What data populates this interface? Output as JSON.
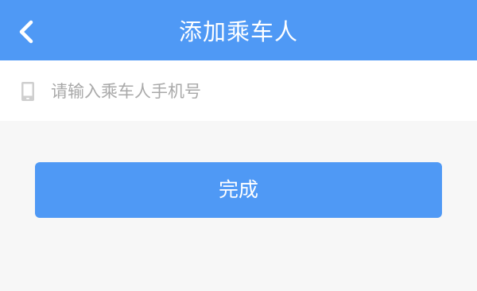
{
  "header": {
    "title": "添加乘车人",
    "back_icon": "chevron-left-icon",
    "background_color": "#4f99f5"
  },
  "form": {
    "phone_icon": "mobile-phone-icon",
    "phone_placeholder": "请输入乘车人手机号",
    "phone_value": ""
  },
  "actions": {
    "done_label": "完成",
    "done_color": "#4f99f5"
  }
}
